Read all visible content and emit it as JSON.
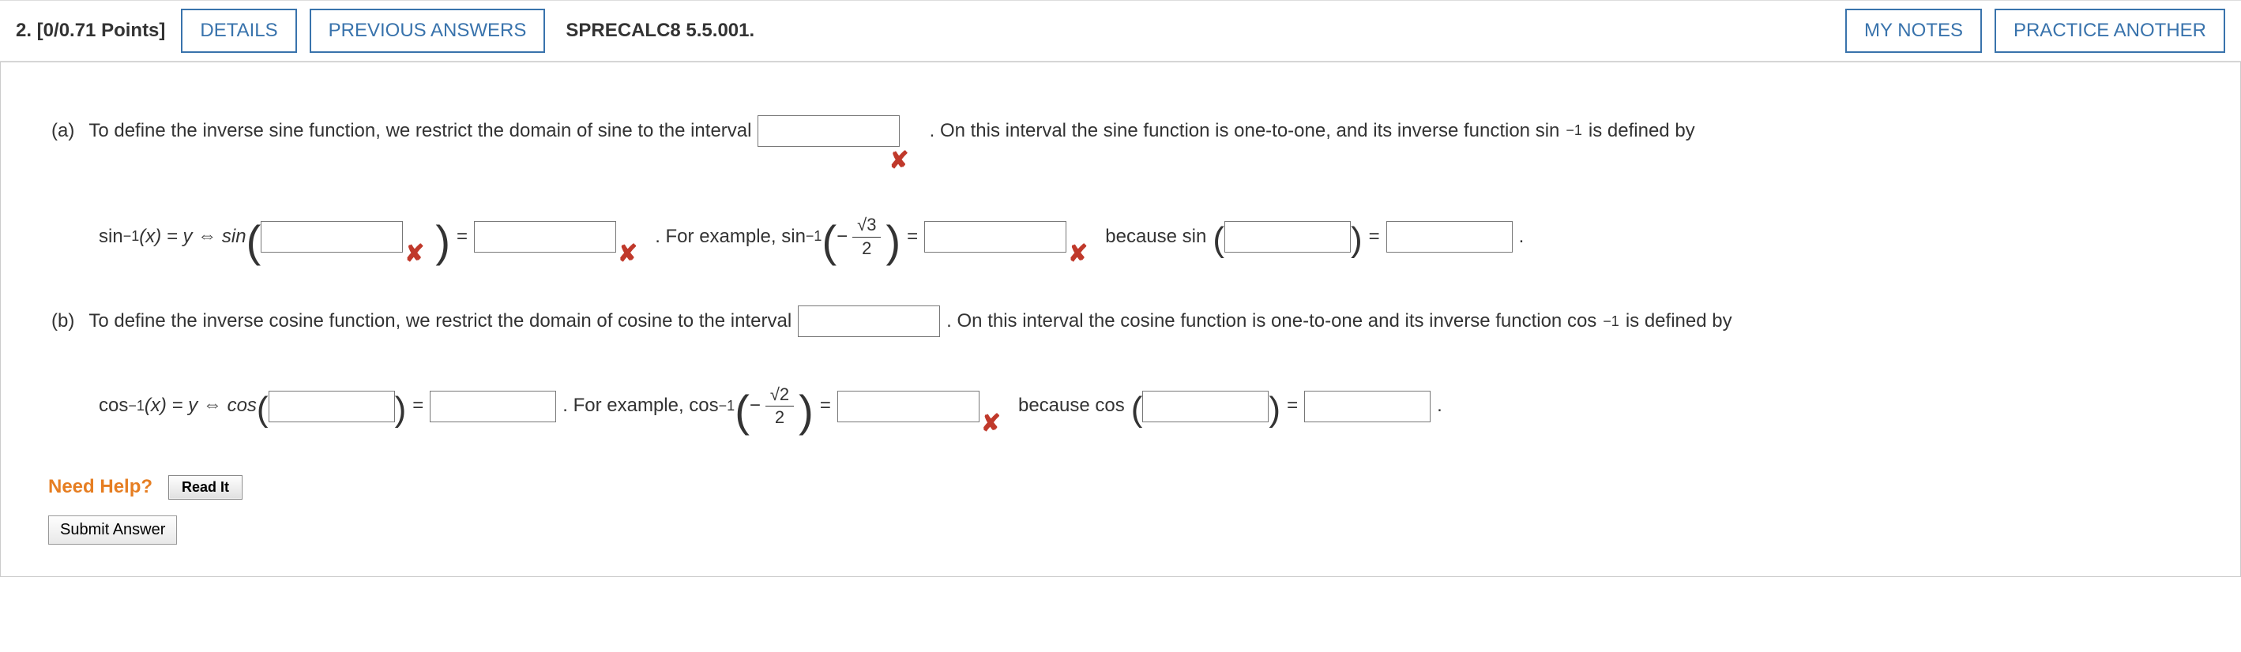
{
  "header": {
    "q_label": "2.  [0/0.71 Points]",
    "details": "DETAILS",
    "prev_answers": "PREVIOUS ANSWERS",
    "ref": "SPRECALC8 5.5.001.",
    "my_notes": "MY NOTES",
    "practice": "PRACTICE ANOTHER"
  },
  "parts": {
    "a": {
      "label": "(a)",
      "t1": "To define the inverse sine function, we restrict the domain of sine to the interval",
      "t2": ". On this interval the sine function is one-to-one, and its inverse function sin",
      "t3": " is defined by",
      "eq_lhs_pre": "sin",
      "eq_lhs_post": "(x) = y ⇔ sin",
      "eq_eq": " = ",
      "example_pre": ". For example, sin",
      "minus": "−",
      "frac_num": "√3",
      "frac_den": "2",
      "example_eq": " = ",
      "because": "because sin",
      "period": "."
    },
    "b": {
      "label": "(b)",
      "t1": "To define the inverse cosine function, we restrict the domain of cosine to the interval",
      "t2": ". On this interval the cosine function is one-to-one and its inverse function cos",
      "t3": " is defined by",
      "eq_lhs_pre": "cos",
      "eq_lhs_post": "(x) = y ⇔ cos",
      "eq_eq": " = ",
      "example_pre": ". For example, cos",
      "minus": "−",
      "frac_num": "√2",
      "frac_den": "2",
      "example_eq": " = ",
      "because": "because cos",
      "period": "."
    }
  },
  "need_help": "Need Help?",
  "read_it": "Read It",
  "submit": "Submit Answer",
  "sup_neg1": "−1"
}
